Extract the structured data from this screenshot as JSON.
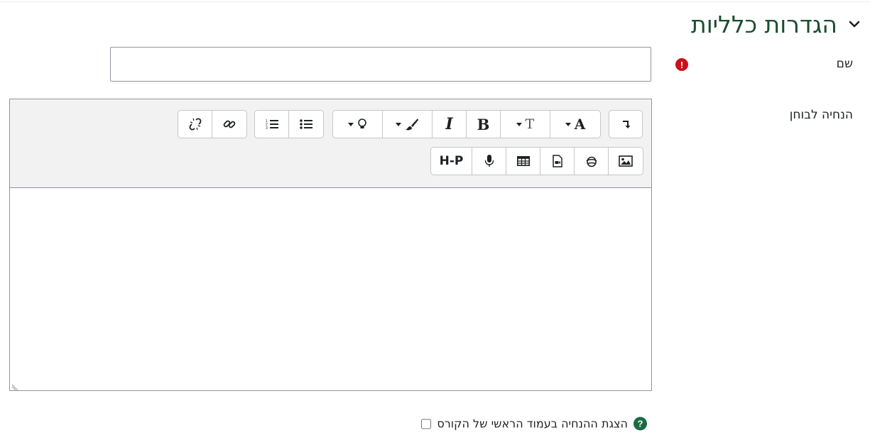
{
  "section": {
    "title": "הגדרות כלליות",
    "chevron_icon": "chevron-down-icon"
  },
  "fields": {
    "name": {
      "label": "שם",
      "value": "",
      "placeholder": "",
      "required_icon": "exclamation-circle-icon"
    },
    "description": {
      "label": "הנחיה לבוחן"
    }
  },
  "editor": {
    "toolbar_icons_row1": [
      "collapse-toolbar-icon",
      "font-size-icon",
      "text-style-icon",
      "bold-icon",
      "italic-icon",
      "brush-icon",
      "lightbulb-icon",
      "bullet-list-icon",
      "numbered-list-icon",
      "link-icon",
      "unlink-icon"
    ],
    "toolbar_icons_row2": [
      "image-icon",
      "media-icon",
      "file-video-icon",
      "table-icon",
      "microphone-icon",
      "h5p-icon"
    ],
    "bold_glyph": "B",
    "italic_glyph": "I",
    "font_glyph": "A",
    "textsize_glyph": "T",
    "h5p_text": "H-P",
    "content": ""
  },
  "show_description": {
    "label": "הצגת ההנחיה בעמוד הראשי של הקורס",
    "checked": false,
    "help_icon": "question-circle-icon"
  },
  "colors": {
    "title": "#1a4d2e",
    "required": "#c9101d",
    "help": "#1b6b45"
  }
}
